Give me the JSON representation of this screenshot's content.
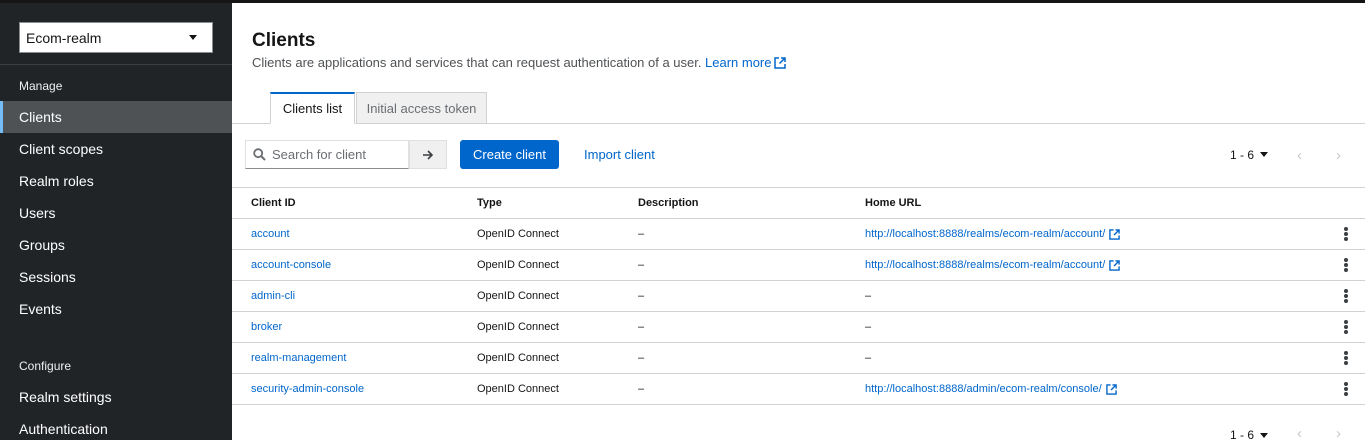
{
  "realm": {
    "name": "Ecom-realm"
  },
  "sidebar": {
    "manage_title": "Manage",
    "configure_title": "Configure",
    "manage_items": [
      {
        "label": "Clients",
        "active": true
      },
      {
        "label": "Client scopes"
      },
      {
        "label": "Realm roles"
      },
      {
        "label": "Users"
      },
      {
        "label": "Groups"
      },
      {
        "label": "Sessions"
      },
      {
        "label": "Events"
      }
    ],
    "configure_items": [
      {
        "label": "Realm settings"
      },
      {
        "label": "Authentication"
      }
    ]
  },
  "page": {
    "title": "Clients",
    "description": "Clients are applications and services that can request authentication of a user.",
    "learn_more": "Learn more"
  },
  "tabs": [
    {
      "label": "Clients list",
      "active": true
    },
    {
      "label": "Initial access token"
    }
  ],
  "toolbar": {
    "search_placeholder": "Search for client",
    "create_label": "Create client",
    "import_label": "Import client",
    "pagination": "1 - 6"
  },
  "table": {
    "columns": [
      "Client ID",
      "Type",
      "Description",
      "Home URL"
    ],
    "rows": [
      {
        "client_id": "account",
        "type": "OpenID Connect",
        "description": "–",
        "home_url": "http://localhost:8888/realms/ecom-realm/account/",
        "external": true
      },
      {
        "client_id": "account-console",
        "type": "OpenID Connect",
        "description": "–",
        "home_url": "http://localhost:8888/realms/ecom-realm/account/",
        "external": true
      },
      {
        "client_id": "admin-cli",
        "type": "OpenID Connect",
        "description": "–",
        "home_url": "–",
        "external": false
      },
      {
        "client_id": "broker",
        "type": "OpenID Connect",
        "description": "–",
        "home_url": "–",
        "external": false
      },
      {
        "client_id": "realm-management",
        "type": "OpenID Connect",
        "description": "–",
        "home_url": "–",
        "external": false
      },
      {
        "client_id": "security-admin-console",
        "type": "OpenID Connect",
        "description": "–",
        "home_url": "http://localhost:8888/admin/ecom-realm/console/",
        "external": true
      }
    ]
  },
  "bottom_pagination": "1 - 6",
  "colors": {
    "accent": "#0066cc",
    "sidebar_bg": "#212427",
    "active_nav_bg": "#4f5255"
  },
  "icons": {
    "search": "search-icon",
    "arrow": "arrow-right-icon",
    "external": "external-link-icon",
    "kebab": "kebab-icon",
    "caret": "caret-down-icon"
  }
}
